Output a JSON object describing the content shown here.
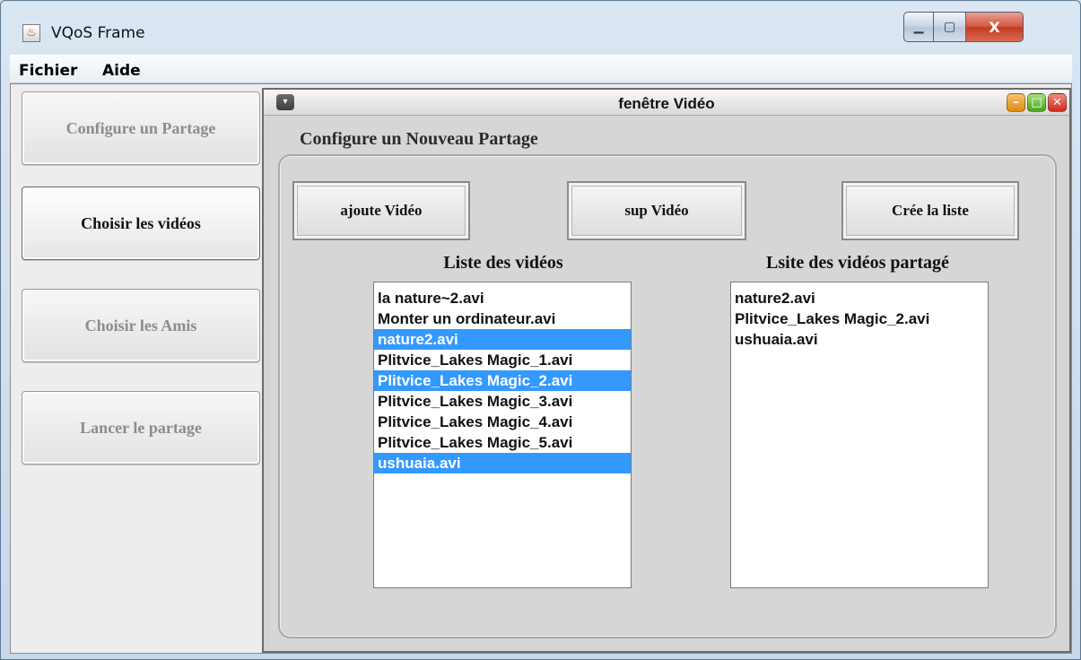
{
  "window": {
    "title": "VQoS Frame",
    "app_icon": "java-cup-icon",
    "controls": {
      "minimize": "▁",
      "maximize": "▢",
      "close": "X"
    }
  },
  "menubar": {
    "items": [
      "Fichier",
      "Aide"
    ]
  },
  "sidebar": {
    "buttons": [
      {
        "label": "Configure un Partage",
        "enabled": false
      },
      {
        "label": "Choisir les vidéos",
        "enabled": true
      },
      {
        "label": "Choisir les Amis",
        "enabled": false
      },
      {
        "label": "Lancer le partage",
        "enabled": false
      }
    ]
  },
  "internal_frame": {
    "title": "fenêtre Vidéo",
    "menu_glyph": "▾",
    "controls": {
      "minimize": "–",
      "maximize": "□",
      "close": "✕"
    },
    "panel_title": "Configure un Nouveau Partage",
    "actions": {
      "add": "ajoute Vidéo",
      "remove": "sup Vidéo",
      "create": "Crée la liste"
    },
    "videos": {
      "heading": "Liste des vidéos",
      "items": [
        {
          "label": "la nature~2.avi",
          "selected": false
        },
        {
          "label": "Monter un ordinateur.avi",
          "selected": false
        },
        {
          "label": "nature2.avi",
          "selected": true
        },
        {
          "label": "Plitvice_Lakes Magic_1.avi",
          "selected": false
        },
        {
          "label": "Plitvice_Lakes Magic_2.avi",
          "selected": true
        },
        {
          "label": "Plitvice_Lakes Magic_3.avi",
          "selected": false
        },
        {
          "label": "Plitvice_Lakes Magic_4.avi",
          "selected": false
        },
        {
          "label": "Plitvice_Lakes Magic_5.avi",
          "selected": false
        },
        {
          "label": "ushuaia.avi",
          "selected": true
        }
      ]
    },
    "shared": {
      "heading": "Lsite des vidéos partagé",
      "items": [
        {
          "label": "nature2.avi"
        },
        {
          "label": "Plitvice_Lakes Magic_2.avi"
        },
        {
          "label": "ushuaia.avi"
        }
      ]
    }
  },
  "colors": {
    "selection": "#3399ff",
    "selection_text": "#ffffff"
  }
}
